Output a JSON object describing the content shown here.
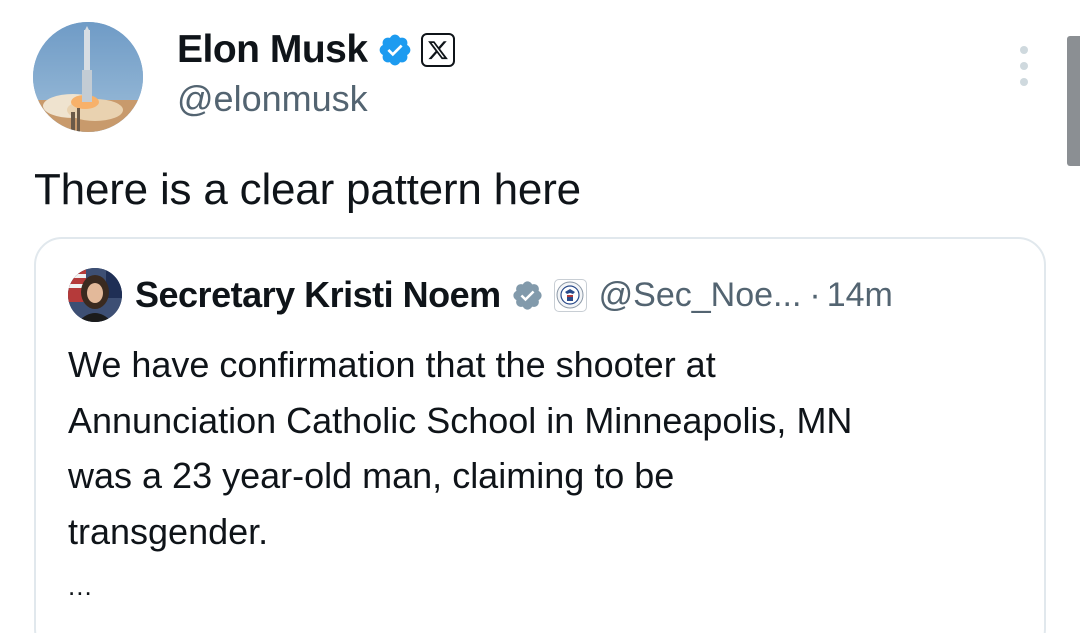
{
  "author": {
    "name": "Elon Musk",
    "handle": "@elonmusk",
    "avatar_icon": "rocket-launch-avatar",
    "badges": [
      "verified-badge-icon",
      "x-affiliation-icon"
    ]
  },
  "tweet": {
    "text": "There is a clear pattern here"
  },
  "quoted_tweet": {
    "author_name": "Secretary Kristi Noem",
    "handle": "@Sec_Noe...",
    "separator": "·",
    "time": "14m",
    "badges": [
      "gray-verified-badge-icon",
      "dhs-seal-icon"
    ],
    "text_lines": [
      "We have confirmation that the shooter at",
      "Annunciation Catholic School in Minneapolis, MN",
      "was a 23 year-old man, claiming to be",
      "transgender."
    ],
    "truncation": "..."
  },
  "colors": {
    "text_primary": "#0f1419",
    "text_secondary": "#536471",
    "verified_blue": "#1d9bf0",
    "verified_gray": "#829aab",
    "card_border": "#e1e8ed"
  }
}
